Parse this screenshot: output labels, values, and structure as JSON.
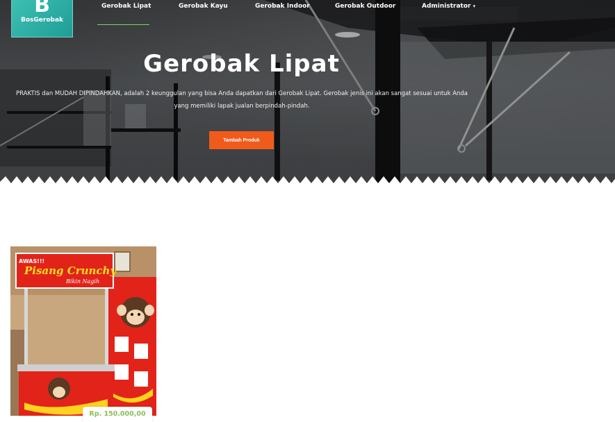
{
  "brand": {
    "logo_letter": "B",
    "logo_text": "BosGerobak"
  },
  "nav": {
    "items": [
      {
        "label": "Gerobak Lipat",
        "active": true
      },
      {
        "label": "Gerobak Kayu"
      },
      {
        "label": "Gerobak Indoor"
      },
      {
        "label": "Gerobak Outdoor"
      },
      {
        "label": "Administrator"
      }
    ],
    "admin_caret_icon": "chevron-down-icon"
  },
  "hero": {
    "title": "Gerobak Lipat",
    "description_line1": "PRAKTIS dan MUDAH DIPINDAHKAN, adalah 2 keunggulan yang bisa Anda dapatkan dari Gerobak Lipat. Gerobak jenis ini akan sangat sesuai untuk Anda",
    "description_line2": "yang memiliki lapak jualan berpindah-pindah.",
    "button_label": "Tambah Produk"
  },
  "products": [
    {
      "sign_line1": "AWAS!!!",
      "sign_line2": "Pisang Crunchy",
      "sign_line3": "Bikin Nagih",
      "price": "Rp. 150.000,00"
    }
  ],
  "colors": {
    "accent": "#f05a1a",
    "brand": "#2bb0a6",
    "nav_active_underline": "#7ed36f",
    "price": "#8bbf5a"
  }
}
